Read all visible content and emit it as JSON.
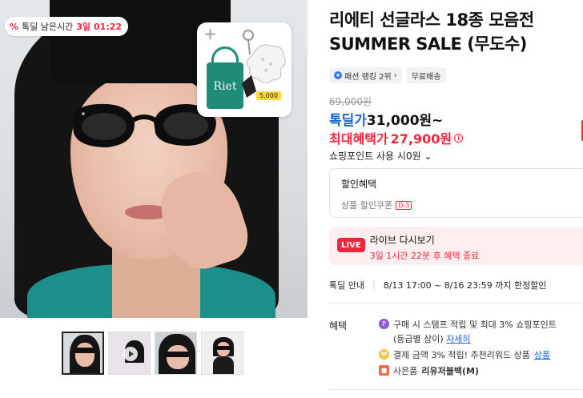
{
  "gallery": {
    "timer": {
      "label": "톡딜 남은시간",
      "days": "3일",
      "time": "01:22"
    },
    "promo_price_tag": "5,000",
    "promo_bag_text": "Riet",
    "thumbnails": [
      "thumb-1",
      "thumb-2",
      "thumb-3",
      "thumb-4"
    ]
  },
  "product": {
    "title_line1": "리에티 선글라스 18종 모음전",
    "title_line2": "SUMMER SALE (무도수)",
    "badge_rank": "패션 랭킹 2위",
    "badge_rank_chevron": "›",
    "badge_shipping": "무료배송",
    "original_price": "69,000원",
    "deal_label": "톡딜가",
    "deal_price": "31,000원~",
    "max_benefit_label": "최대혜택가",
    "max_benefit_price": "27,900원",
    "point_text": "쇼핑포인트 사용 시0원",
    "point_chevron": "⌄",
    "coupon_title": "할인혜택",
    "coupon_sub": "상품 할인쿠폰",
    "coupon_badge": "D-3",
    "live_tag": "LIVE",
    "live_title": "라이브 다시보기",
    "live_sub": "3일 1시간 22분 후 혜택 종료",
    "deal_info_key": "톡딜 안내",
    "deal_info_value": "8/13 17:00 ~ 8/16 23:59 까지 한정할인",
    "benefit_label": "혜택",
    "benefits": {
      "b1_text": "구매 시 스탬프 적립 및 최대 3% 쇼핑포인트",
      "b1_sub": "(등급별 상이)",
      "b1_link": "자세히",
      "b2_text": "결제 금액 3% 적립! 추천리워드 상품",
      "b2_link": "상품",
      "b3_prefix": "사은품",
      "b3_value": "리유저블백(M)"
    }
  },
  "colors": {
    "accent_red": "#f0263f",
    "accent_blue": "#1a64d8"
  }
}
